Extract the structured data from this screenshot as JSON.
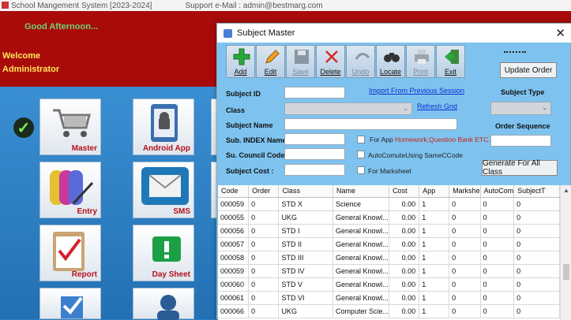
{
  "app": {
    "title": "School Mangement System [2023-2024]",
    "support": "Support e-Mail : admin@bestmarg.com",
    "greeting": "Good Afternoon...",
    "welcome": "Welcome",
    "user": "Administrator"
  },
  "tiles": [
    {
      "label": "Master",
      "icon": "cart-icon"
    },
    {
      "label": "Android App",
      "icon": "android-icon"
    },
    {
      "label": "Entry",
      "icon": "binders-icon"
    },
    {
      "label": "SMS",
      "icon": "envelope-icon"
    },
    {
      "label": "Report",
      "icon": "clipboard-icon"
    },
    {
      "label": "Day Sheet",
      "icon": "alert-icon"
    }
  ],
  "dialog": {
    "title": "Subject Master",
    "close": "✕",
    "toolbar": [
      {
        "label": "Add",
        "icon": "plus-icon",
        "enabled": true
      },
      {
        "label": "Edit",
        "icon": "pencil-icon",
        "enabled": true
      },
      {
        "label": "Save",
        "icon": "floppy-icon",
        "enabled": false
      },
      {
        "label": "Delete",
        "icon": "x-icon",
        "enabled": true
      },
      {
        "label": "Undo",
        "icon": "undo-icon",
        "enabled": false
      },
      {
        "label": "Locate",
        "icon": "binoculars-icon",
        "enabled": true
      },
      {
        "label": "Print",
        "icon": "printer-icon",
        "enabled": false
      },
      {
        "label": "Exit",
        "icon": "exit-icon",
        "enabled": true
      }
    ],
    "update_order": "Update Order",
    "subject_type_label": "Subject Type",
    "order_sequence_label": "Order Sequence",
    "generate_all": "Generate For All Class",
    "import_link": "Import From Previous Session",
    "refresh_link": "Refresh Grid",
    "fields": {
      "subject_id": "Subject ID",
      "class": "Class",
      "subject_name": "Subject Name",
      "sub_index_name": "Sub. INDEX  Name",
      "su_council_code": "Su. Council Code",
      "subject_cost": "Subject Cost :"
    },
    "checks": {
      "for_app": "For App",
      "for_app_note": "Homework,Question Bank ETC.",
      "auto_comute": "AutoComuteUsing SameCCode",
      "for_marksheet": "For Marksheet"
    },
    "grid": {
      "columns": [
        "Code",
        "Order",
        "Class",
        "Name",
        "Cost",
        "App",
        "Markshe",
        "AutoCom",
        "SubjectT"
      ],
      "rows": [
        [
          "000059",
          "0",
          "STD X",
          "Science",
          "0.00",
          "1",
          "0",
          "0",
          "0"
        ],
        [
          "000055",
          "0",
          "UKG",
          "General Knowl...",
          "0.00",
          "1",
          "0",
          "0",
          "0"
        ],
        [
          "000056",
          "0",
          "STD I",
          "General Knowl...",
          "0.00",
          "1",
          "0",
          "0",
          "0"
        ],
        [
          "000057",
          "0",
          "STD II",
          "General Knowl...",
          "0.00",
          "1",
          "0",
          "0",
          "0"
        ],
        [
          "000058",
          "0",
          "STD III",
          "General Knowl...",
          "0.00",
          "1",
          "0",
          "0",
          "0"
        ],
        [
          "000059",
          "0",
          "STD IV",
          "General Knowl...",
          "0.00",
          "1",
          "0",
          "0",
          "0"
        ],
        [
          "000060",
          "0",
          "STD V",
          "General Knowl...",
          "0.00",
          "1",
          "0",
          "0",
          "0"
        ],
        [
          "000061",
          "0",
          "STD VI",
          "General Knowl...",
          "0.00",
          "1",
          "0",
          "0",
          "0"
        ],
        [
          "000066",
          "0",
          "UKG",
          "Computer Scie...",
          "0.00",
          "1",
          "0",
          "0",
          "0"
        ]
      ]
    }
  }
}
